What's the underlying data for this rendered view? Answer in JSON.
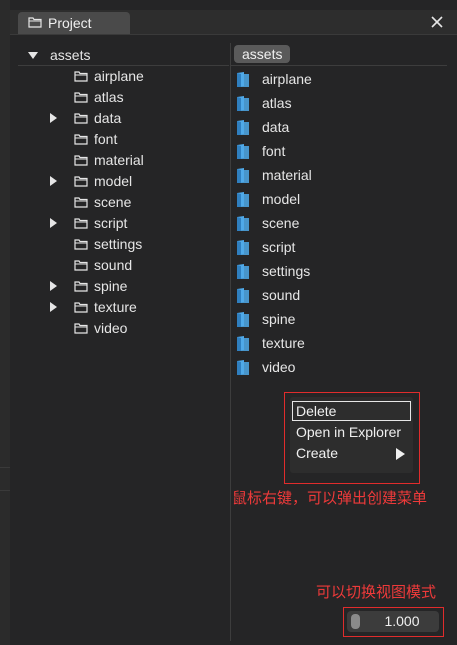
{
  "window": {
    "tab_title": "Project",
    "tab_icon": "folder-outline-icon",
    "close_icon": "close-icon"
  },
  "tree": {
    "root": {
      "label": "assets",
      "expanded": true
    },
    "items": [
      {
        "label": "airplane",
        "has_children": false
      },
      {
        "label": "atlas",
        "has_children": false
      },
      {
        "label": "data",
        "has_children": true
      },
      {
        "label": "font",
        "has_children": false
      },
      {
        "label": "material",
        "has_children": false
      },
      {
        "label": "model",
        "has_children": true
      },
      {
        "label": "scene",
        "has_children": false
      },
      {
        "label": "script",
        "has_children": true
      },
      {
        "label": "settings",
        "has_children": false
      },
      {
        "label": "sound",
        "has_children": false
      },
      {
        "label": "spine",
        "has_children": true
      },
      {
        "label": "texture",
        "has_children": true
      },
      {
        "label": "video",
        "has_children": false
      }
    ]
  },
  "browser": {
    "breadcrumb": "assets",
    "folder_color": "#4fa9e8",
    "items": [
      {
        "label": "airplane"
      },
      {
        "label": "atlas"
      },
      {
        "label": "data"
      },
      {
        "label": "font"
      },
      {
        "label": "material"
      },
      {
        "label": "model"
      },
      {
        "label": "scene"
      },
      {
        "label": "script"
      },
      {
        "label": "settings"
      },
      {
        "label": "sound"
      },
      {
        "label": "spine"
      },
      {
        "label": "texture"
      },
      {
        "label": "video"
      }
    ]
  },
  "context_menu": {
    "items": [
      {
        "label": "Delete",
        "selected": true
      },
      {
        "label": "Open in Explorer"
      },
      {
        "label": "Create",
        "submenu": true
      }
    ]
  },
  "annotations": {
    "context_menu_note": "鼠标右键，可以弹出创建菜单",
    "view_mode_note": "可以切换视图模式",
    "highlight_color": "#e02c2c"
  },
  "zoom": {
    "value": "1.000"
  }
}
